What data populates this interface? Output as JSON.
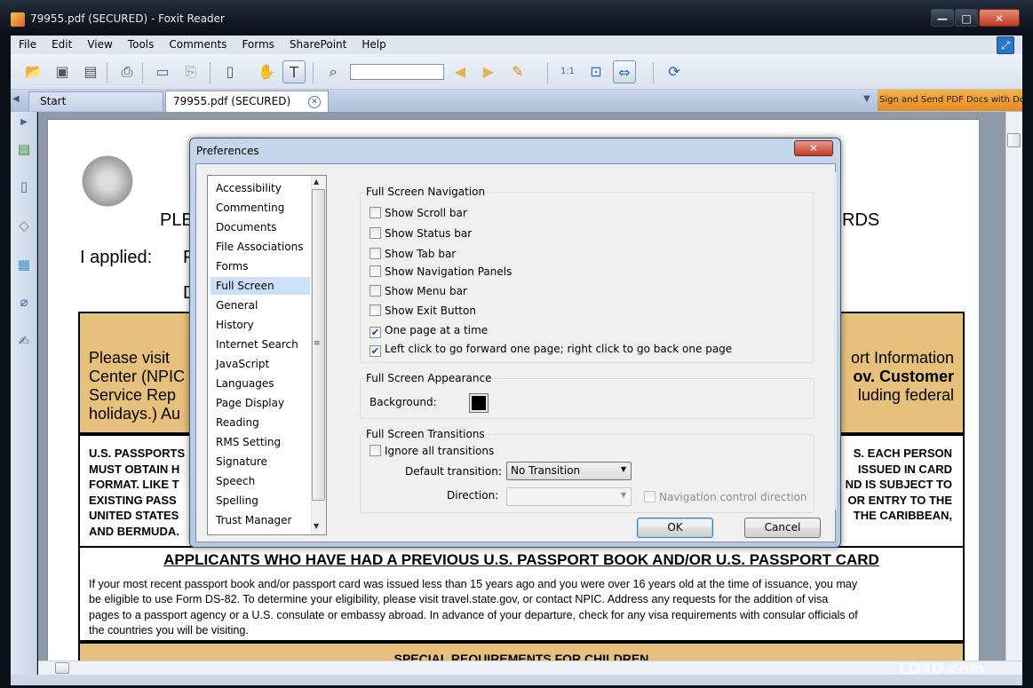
{
  "window": {
    "title": "79955.pdf (SECURED) - Foxit Reader",
    "min_glyph": "—",
    "max_glyph": "□",
    "close_glyph": "✕"
  },
  "menu": [
    "File",
    "Edit",
    "View",
    "Tools",
    "Comments",
    "Forms",
    "SharePoint",
    "Help"
  ],
  "toolbar": {
    "find_value": "",
    "icons": [
      "open-icon",
      "save-icon",
      "save-as-icon",
      "print-icon",
      "monitor-icon",
      "scan-icon",
      "page-icon",
      "hand-icon",
      "select-text-icon",
      "find-icon",
      "prev-icon",
      "next-icon",
      "highlight-icon",
      "actual-size-icon",
      "fit-page-icon",
      "fit-width-icon",
      "share-icon"
    ]
  },
  "tabs": {
    "start": "Start",
    "doc": "79955.pdf (SECURED)",
    "ad": "Sign and Send PDF Docs with DocuSign"
  },
  "document": {
    "heading_left": "PLE",
    "heading_right": "RDS",
    "applied": "I applied:",
    "applied_cut": "F",
    "line_d": "D",
    "tan_left": [
      "Please visit",
      "Center (NPIC",
      "Service Rep",
      "holidays.) Au"
    ],
    "tan_right": [
      "ort Information",
      "ov.  Customer",
      "luding federal"
    ],
    "passport_left": [
      "U.S. PASSPORTS",
      "MUST OBTAIN H",
      "FORMAT.  LIKE T",
      "EXISTING PASS",
      "UNITED STATES",
      "AND BERMUDA."
    ],
    "passport_right": [
      "S.  EACH PERSON",
      "ISSUED IN CARD",
      "ND IS SUBJECT TO",
      "OR ENTRY TO THE",
      "THE CARIBBEAN,"
    ],
    "section_title": "APPLICANTS WHO HAVE HAD A PREVIOUS U.S. PASSPORT BOOK AND/OR U.S. PASSPORT CARD",
    "section_body": [
      "If your most recent passport book and/or passport card was issued less than 15 years ago and you were over 16 years old at the time of issuance, you may",
      "be eligible to use Form DS-82. To determine your eligibility, please visit travel.state.gov, or contact NPIC.  Address any requests for the addition of visa",
      "pages to a passport agency or a U.S. consulate or embassy abroad.  In advance of your departure, check for any visa requirements with consular officials of",
      "the countries you will be visiting."
    ],
    "children_title": "SPECIAL REQUIREMENTS FOR CHILDREN"
  },
  "dialog": {
    "title": "Preferences",
    "close_glyph": "✕",
    "categories": [
      "Accessibility",
      "Commenting",
      "Documents",
      "File Associations",
      "Forms",
      "Full Screen",
      "General",
      "History",
      "Internet Search",
      "JavaScript",
      "Languages",
      "Page Display",
      "Reading",
      "RMS Setting",
      "Signature",
      "Speech",
      "Spelling",
      "Trust Manager"
    ],
    "selected_category": "Full Screen",
    "nav_group": {
      "title": "Full Screen Navigation",
      "options": [
        {
          "label": "Show Scroll bar",
          "checked": false
        },
        {
          "label": "Show Status bar",
          "checked": false
        },
        {
          "label": "Show Tab bar",
          "checked": false
        },
        {
          "label": "Show Navigation Panels",
          "checked": false
        },
        {
          "label": "Show Menu bar",
          "checked": false
        },
        {
          "label": "Show Exit Button",
          "checked": false
        },
        {
          "label": "One page at a time",
          "checked": true
        },
        {
          "label": "Left click to go forward one page; right click to go back one page",
          "checked": true
        }
      ]
    },
    "appearance_group": {
      "title": "Full Screen Appearance",
      "background_label": "Background:",
      "background_color": "#000000"
    },
    "transitions_group": {
      "title": "Full Screen Transitions",
      "ignore_label": "Ignore all transitions",
      "ignore_checked": false,
      "default_label": "Default transition:",
      "default_value": "No Transition",
      "direction_label": "Direction:",
      "direction_value": "",
      "nav_control_label": "Navigation control direction"
    },
    "ok_label": "OK",
    "cancel_label": "Cancel"
  },
  "watermark": "LO4D.com",
  "colors": {
    "tan": "#e7c17b",
    "selection": "#cce0f7",
    "tab_bar": "#aebfda"
  }
}
